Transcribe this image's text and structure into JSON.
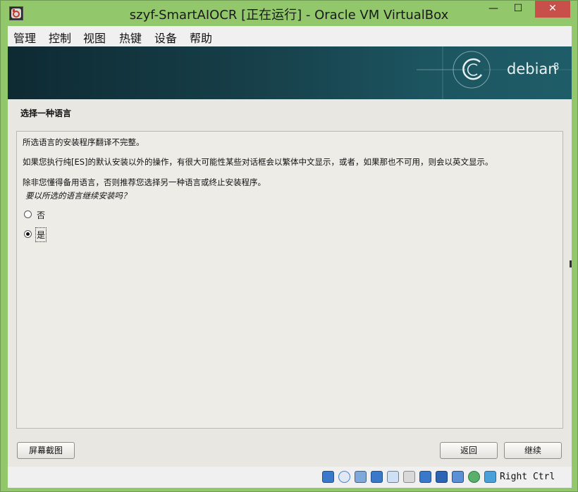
{
  "window": {
    "title": "szyf-SmartAIOCR [正在运行] - Oracle VM VirtualBox",
    "minimize_glyph": "—",
    "maximize_glyph": "☐",
    "close_glyph": "✕"
  },
  "menu": [
    "管理",
    "控制",
    "视图",
    "热键",
    "设备",
    "帮助"
  ],
  "guest": {
    "banner": {
      "brand": "debian",
      "version": "8"
    },
    "heading": "选择一种语言",
    "line1": "所选语言的安装程序翻译不完整。",
    "line2": "如果您执行纯[ES]的默认安装以外的操作，有很大可能性某些对话框会以繁体中文显示，或者，如果那也不可用，则会以英文显示。",
    "line3": "除非您懂得备用语言，否则推荐您选择另一种语言或终止安装程序。",
    "question": "要以所选的语言继续安装吗？",
    "options": [
      {
        "label": "否",
        "selected": false
      },
      {
        "label": "是",
        "selected": true
      }
    ],
    "screenshot_button": "屏幕截图",
    "back_button": "返回",
    "continue_button": "继续"
  },
  "statusbar": {
    "icons": [
      "hard-disk-icon",
      "optical-drive-icon",
      "audio-icon",
      "network-icon",
      "usb-icon",
      "shared-folder-icon",
      "display-icon",
      "video-capture-icon",
      "cpu-virtualization-icon",
      "mouse-integration-icon",
      "keyboard-capture-icon"
    ],
    "host_key": "Right Ctrl"
  },
  "colors": {
    "window_frame": "#92c86b",
    "close_button": "#c7514a",
    "banner_dark": "#0e2a33",
    "banner_light": "#1e5d68",
    "installer_bg": "#e8e7e2"
  }
}
